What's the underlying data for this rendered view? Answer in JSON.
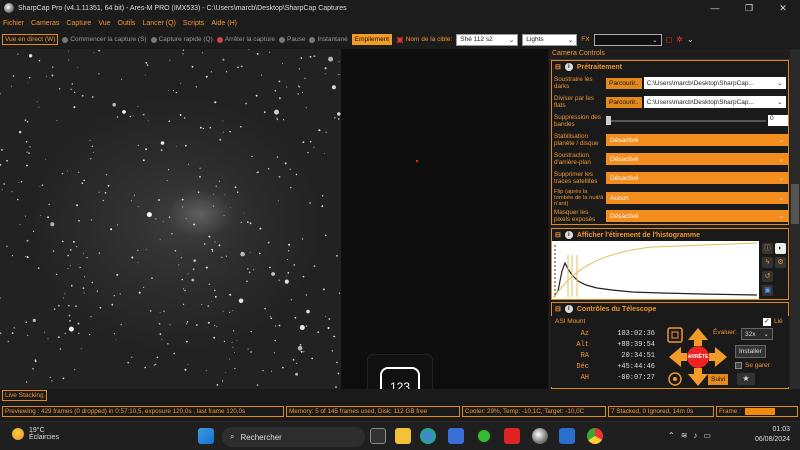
{
  "window": {
    "title": "SharpCap Pro (v4.1.11351, 64 bit) - Ares-M PRO (IMX533) - C:\\Users\\marcb\\Desktop\\SharpCap Captures",
    "controls": [
      "—",
      "❐",
      "✕"
    ]
  },
  "menu": [
    "Fichier",
    "Cameras",
    "Capture",
    "Vue",
    "Outils",
    "Lancer (Q)",
    "Scripts",
    "Aide (H)"
  ],
  "toolbar": {
    "live_view": "Vue en direct (W)",
    "start_capture": "Commencer la capture (S)",
    "quick_capture": "Capture rapide (Q)",
    "stop_capture": "Arrêter la capture",
    "pause": "Pause",
    "snapshot": "Instantané",
    "stacking": "Empilement",
    "target_label": "Nom de la cible:",
    "target_value": "Shé 112 s2",
    "frame_type": "Lights",
    "fx_label": "FX",
    "fx_value": ""
  },
  "camera_controls": {
    "header": "Camera Controls",
    "preprocessing": {
      "title": "Prétraitement",
      "subtract_darks_label": "Soustraire les darks",
      "subtract_darks_button": "Parcourir..",
      "subtract_darks_path": "C:\\Users\\marcb\\Desktop\\SharpCap...",
      "divide_flats_label": "Diviser par les flats",
      "divide_flats_button": "Parcourir..",
      "divide_flats_path": "C:\\Users\\marcb\\Desktop\\SharpCap...",
      "banding_label": "Suppression des bandes",
      "banding_value": "0",
      "stabilization_label": "Stabilisation planète / disque",
      "stabilization_value": "Désactivé",
      "background_label": "Soustraction d'arrière-plan",
      "background_value": "Désactivé",
      "satellite_label": "Supprimer les traces satellites",
      "satellite_value": "Désactivé",
      "flip_label": "Flip (après la tombée de la nuit/à n'ant)",
      "flip_value": "Aucun",
      "hot_pixels_label": "Masquer les pixels exposés",
      "hot_pixels_value": "Désactivé"
    },
    "histogram": {
      "title": "Afficher l'étirement de l'histogramme"
    },
    "telescope": {
      "title": "Contrôles du Télescope",
      "mount": "ASI Mount",
      "az_label": "Az",
      "az_value": "103:02:36",
      "alt_label": "Alt",
      "alt_value": "+88:39:54",
      "ra_label": "RA",
      "ra_value": "20:34:51",
      "dec_label": "Déc",
      "dec_value": "+45:44:46",
      "ah_label": "AH",
      "ah_value": "-00:07:27",
      "stop_label": "ARRÊTE",
      "lie_label": "Lié",
      "rate_label": "Évaluer:",
      "rate_value": "32x",
      "install_button": "Installer",
      "park_label": "Se garer",
      "follow_button": "Suivi"
    }
  },
  "live_stacking_tab": "Live Stacking",
  "counter_badge": "123",
  "status": {
    "previewing": "Previewing : 429 frames (0 dropped) in 0:57:10,5, exposure 120,0s , last frame 120,0s",
    "memory": "Memory: 5 of 145 frames used, Disk: 112 GB free",
    "cooler": "Cooler: 29%, Temp: -10,1C, Target: -10,0C",
    "stacked": "7 Stacked, 0 Ignored, 14m 0s",
    "frame_label": "Frame :"
  },
  "taskbar": {
    "temperature": "19°C",
    "weather": "Éclaircies",
    "search_placeholder": "Rechercher",
    "time": "01:03",
    "date": "06/08/2024"
  }
}
